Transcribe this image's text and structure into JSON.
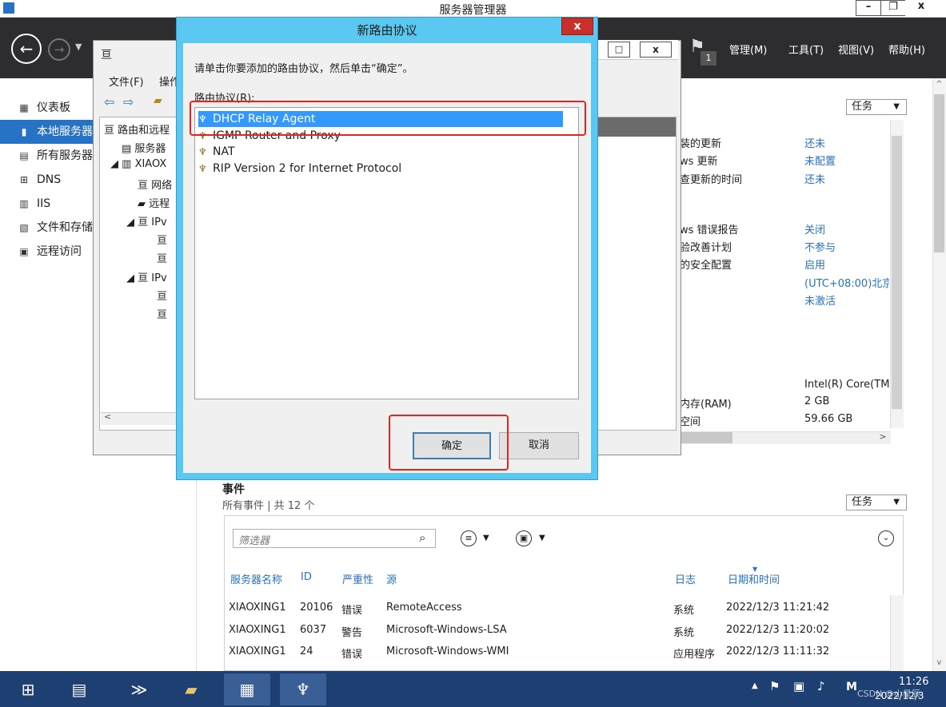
{
  "server_manager": {
    "title": "服务器管理器",
    "header_menus": [
      "管理(M)",
      "工具(T)",
      "视图(V)",
      "帮助(H)"
    ],
    "flag_count": "1",
    "nav": [
      {
        "label": "仪表板",
        "icon": "dashboard-icon"
      },
      {
        "label": "本地服务器",
        "icon": "local-server-icon",
        "active": true
      },
      {
        "label": "所有服务器",
        "icon": "all-servers-icon"
      },
      {
        "label": "DNS",
        "icon": "dns-icon"
      },
      {
        "label": "IIS",
        "icon": "iis-icon"
      },
      {
        "label": "文件和存储服务",
        "icon": "storage-icon"
      },
      {
        "label": "远程访问",
        "icon": "remote-access-icon"
      }
    ],
    "tasks_label": "任务",
    "properties": [
      {
        "label": "装的更新",
        "value": "还未"
      },
      {
        "label": "ws 更新",
        "value": "未配置"
      },
      {
        "label": "查更新的时间",
        "value": "还未"
      },
      {
        "label": "ws 错误报告",
        "value": "关闭"
      },
      {
        "label": "验改善计划",
        "value": "不参与"
      },
      {
        "label": "的安全配置",
        "value": "启用"
      },
      {
        "label": "",
        "value": "(UTC+08:00)北京"
      },
      {
        "label": "",
        "value": "未激活"
      },
      {
        "label": "",
        "value": "Intel(R) Core(TM"
      },
      {
        "label": "内存(RAM)",
        "value": "2 GB"
      },
      {
        "label": "空间",
        "value": "59.66 GB"
      }
    ],
    "events": {
      "title": "事件",
      "subtitle": "所有事件 | 共 12 个",
      "tasks_label": "任务",
      "filter_placeholder": "筛选器",
      "columns": [
        "服务器名称",
        "ID",
        "严重性",
        "源",
        "日志",
        "日期和时间"
      ],
      "rows": [
        [
          "XIAOXING1",
          "20106",
          "错误",
          "RemoteAccess",
          "系统",
          "2022/12/3 11:21:42"
        ],
        [
          "XIAOXING1",
          "6037",
          "警告",
          "Microsoft-Windows-LSA",
          "系统",
          "2022/12/3 11:20:02"
        ],
        [
          "XIAOXING1",
          "24",
          "错误",
          "Microsoft-Windows-WMI",
          "应用程序",
          "2022/12/3 11:11:32"
        ]
      ]
    }
  },
  "rras": {
    "menus": [
      "文件(F)",
      "操作"
    ],
    "tree": [
      "路由和远程",
      "服务器",
      "XIAOX",
      "网络",
      "远程",
      "IPv",
      "IPv"
    ]
  },
  "dialog": {
    "title": "新路由协议",
    "close": "x",
    "instruction": "请单击你要添加的路由协议，然后单击“确定”。",
    "list_label": "路由协议(R):",
    "protocols": [
      "DHCP Relay Agent",
      "IGMP Router and Proxy",
      "NAT",
      "RIP Version 2 for Internet Protocol"
    ],
    "selected_index": 0,
    "ok_label": "确定",
    "cancel_label": "取消"
  },
  "taskbar": {
    "time": "11:26",
    "date": "2022/12/3",
    "watermark": "CSDN @小星辰"
  },
  "colors": {
    "accent": "#2672c5",
    "dialog_frame": "#5ac8f0",
    "selection": "#3399ff",
    "highlight_box": "#e8221c",
    "taskbar": "#1d3f72"
  }
}
